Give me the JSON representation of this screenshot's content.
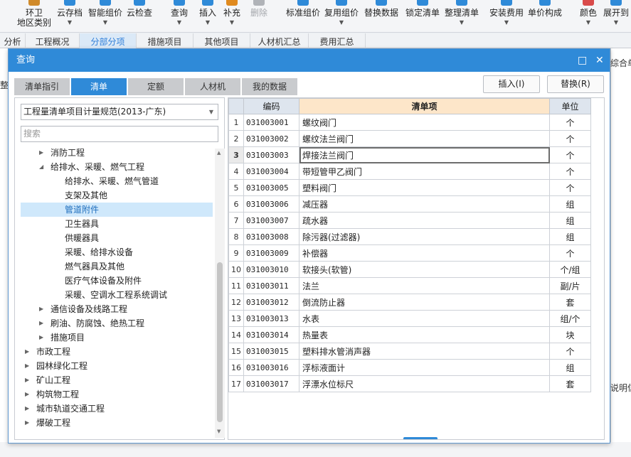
{
  "toolbar": {
    "items": [
      {
        "l1": "环卫",
        "l2": "地区类别",
        "icon": "region-icon"
      },
      {
        "l1": "云存档",
        "icon": "cloud-save-icon"
      },
      {
        "l1": "智能组价",
        "icon": "smart-price-icon"
      },
      {
        "l1": "云检查",
        "icon": "cloud-check-icon"
      },
      {
        "l1": "查询",
        "icon": "query-icon"
      },
      {
        "l1": "插入",
        "icon": "insert-icon"
      },
      {
        "l1": "补充",
        "icon": "supplement-icon"
      },
      {
        "l1": "删除",
        "icon": "delete-icon"
      },
      {
        "l1": "标准组价",
        "icon": "standard-price-icon"
      },
      {
        "l1": "复用组价",
        "icon": "reuse-price-icon"
      },
      {
        "l1": "替换数据",
        "icon": "replace-data-icon"
      },
      {
        "l1": "锁定清单",
        "icon": "lock-list-icon"
      },
      {
        "l1": "整理清单",
        "icon": "organize-list-icon"
      },
      {
        "l1": "安装费用",
        "icon": "install-fee-icon"
      },
      {
        "l1": "单价构成",
        "icon": "unit-price-icon"
      },
      {
        "l1": "颜色",
        "icon": "color-icon"
      },
      {
        "l1": "展开到",
        "icon": "expand-icon"
      }
    ]
  },
  "page_tabs": [
    "分析",
    "工程概况",
    "分部分项",
    "措施项目",
    "其他项目",
    "人材机汇总",
    "费用汇总"
  ],
  "bg": {
    "right_top": "综合单价",
    "right_bottom": "说明信息",
    "left_label": "整"
  },
  "dialog": {
    "title": "查询",
    "tabs": [
      "清单指引",
      "清单",
      "定额",
      "人材机",
      "我的数据"
    ],
    "insert_button": "插入(I)",
    "replace_button": "替换(R)",
    "spec_select": "工程量清单项目计量规范(2013-广东)",
    "search_placeholder": "搜索",
    "tree": [
      {
        "label": "消防工程",
        "indent": 2,
        "toggle": "right"
      },
      {
        "label": "给排水、采暖、燃气工程",
        "indent": 2,
        "toggle": "down"
      },
      {
        "label": "给排水、采暖、燃气管道",
        "indent": 3,
        "toggle": ""
      },
      {
        "label": "支架及其他",
        "indent": 3,
        "toggle": ""
      },
      {
        "label": "管道附件",
        "indent": 3,
        "toggle": "",
        "selected": true
      },
      {
        "label": "卫生器具",
        "indent": 3,
        "toggle": ""
      },
      {
        "label": "供暖器具",
        "indent": 3,
        "toggle": ""
      },
      {
        "label": "采暖、给排水设备",
        "indent": 3,
        "toggle": ""
      },
      {
        "label": "燃气器具及其他",
        "indent": 3,
        "toggle": ""
      },
      {
        "label": "医疗气体设备及附件",
        "indent": 3,
        "toggle": ""
      },
      {
        "label": "采暖、空调水工程系统调试",
        "indent": 3,
        "toggle": ""
      },
      {
        "label": "通信设备及线路工程",
        "indent": 2,
        "toggle": "right"
      },
      {
        "label": "刷油、防腐蚀、绝热工程",
        "indent": 2,
        "toggle": "right"
      },
      {
        "label": "措施项目",
        "indent": 2,
        "toggle": "right"
      },
      {
        "label": "市政工程",
        "indent": 1,
        "toggle": "right"
      },
      {
        "label": "园林绿化工程",
        "indent": 1,
        "toggle": "right"
      },
      {
        "label": "矿山工程",
        "indent": 1,
        "toggle": "right"
      },
      {
        "label": "构筑物工程",
        "indent": 1,
        "toggle": "right"
      },
      {
        "label": "城市轨道交通工程",
        "indent": 1,
        "toggle": "right"
      },
      {
        "label": "爆破工程",
        "indent": 1,
        "toggle": "right"
      }
    ],
    "grid": {
      "headers": [
        "",
        "编码",
        "清单项",
        "单位"
      ],
      "current_row": 3,
      "rows": [
        {
          "n": "1",
          "code": "031003001",
          "name": "螺纹阀门",
          "unit": "个"
        },
        {
          "n": "2",
          "code": "031003002",
          "name": "螺纹法兰阀门",
          "unit": "个"
        },
        {
          "n": "3",
          "code": "031003003",
          "name": "焊接法兰阀门",
          "unit": "个"
        },
        {
          "n": "4",
          "code": "031003004",
          "name": "带短管甲乙阀门",
          "unit": "个"
        },
        {
          "n": "5",
          "code": "031003005",
          "name": "塑料阀门",
          "unit": "个"
        },
        {
          "n": "6",
          "code": "031003006",
          "name": "减压器",
          "unit": "组"
        },
        {
          "n": "7",
          "code": "031003007",
          "name": "疏水器",
          "unit": "组"
        },
        {
          "n": "8",
          "code": "031003008",
          "name": "除污器(过滤器)",
          "unit": "组"
        },
        {
          "n": "9",
          "code": "031003009",
          "name": "补偿器",
          "unit": "个"
        },
        {
          "n": "10",
          "code": "031003010",
          "name": "软接头(软管)",
          "unit": "个/组"
        },
        {
          "n": "11",
          "code": "031003011",
          "name": "法兰",
          "unit": "副/片"
        },
        {
          "n": "12",
          "code": "031003012",
          "name": "倒流防止器",
          "unit": "套"
        },
        {
          "n": "13",
          "code": "031003013",
          "name": "水表",
          "unit": "组/个"
        },
        {
          "n": "14",
          "code": "031003014",
          "name": "热量表",
          "unit": "块"
        },
        {
          "n": "15",
          "code": "031003015",
          "name": "塑料排水管消声器",
          "unit": "个"
        },
        {
          "n": "16",
          "code": "031003016",
          "name": "浮标液面计",
          "unit": "组"
        },
        {
          "n": "17",
          "code": "031003017",
          "name": "浮漂水位标尺",
          "unit": "套"
        }
      ]
    }
  },
  "colors": {
    "accent": "#2f8ad8",
    "selected_tree": "#cfe8fb",
    "header_highlight": "#fde6c9"
  }
}
